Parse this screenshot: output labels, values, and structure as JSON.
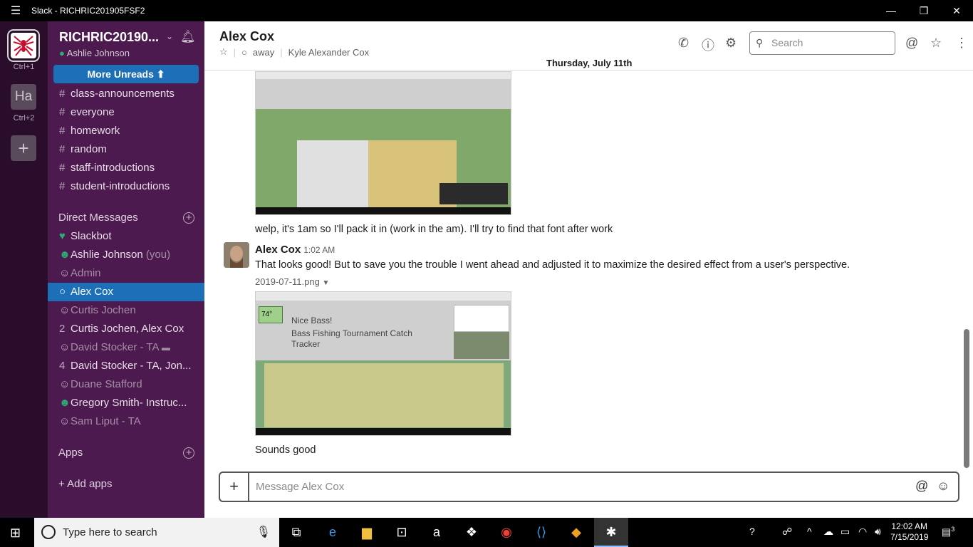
{
  "window": {
    "title": "Slack - RICHRIC201905FSF2",
    "menu_icon": "hamburger-icon",
    "minimize": "—",
    "maximize": "❐",
    "close": "✕"
  },
  "workspaces": [
    {
      "label": "Ctrl+1",
      "active": true
    },
    {
      "initials": "Ha",
      "label": "Ctrl+2"
    }
  ],
  "sidebar": {
    "team_name": "RICHRIC20190...",
    "user": "Ashlie Johnson",
    "more_unreads": "More Unreads",
    "channels": [
      "class-announcements",
      "everyone",
      "homework",
      "random",
      "staff-introductions",
      "student-introductions"
    ],
    "dm_header": "Direct Messages",
    "dms": [
      {
        "name": "Slackbot",
        "prefix": "♥",
        "faded": false
      },
      {
        "name": "Ashlie Johnson",
        "suffix": "(you)",
        "prefix": "☻",
        "faded": false
      },
      {
        "name": "Admin",
        "prefix": "☺",
        "faded": true
      },
      {
        "name": "Alex Cox",
        "prefix": "○",
        "faded": false,
        "active": true
      },
      {
        "name": "Curtis Jochen",
        "prefix": "☺",
        "faded": true
      },
      {
        "name": "Curtis Jochen, Alex Cox",
        "prefix": "2",
        "faded": false
      },
      {
        "name": "David Stocker - TA",
        "prefix": "☺",
        "faded": true
      },
      {
        "name": "David Stocker - TA, Jon...",
        "prefix": "4",
        "faded": false
      },
      {
        "name": "Duane Stafford",
        "prefix": "☺",
        "faded": true
      },
      {
        "name": "Gregory Smith- Instruc...",
        "prefix": "☻",
        "faded": false
      },
      {
        "name": "Sam Liput - TA",
        "prefix": "☺",
        "faded": true
      }
    ],
    "apps_header": "Apps",
    "add_apps": "+ Add apps"
  },
  "channel": {
    "name": "Alex Cox",
    "presence": "away",
    "full_name": "Kyle Alexander Cox",
    "search_placeholder": "Search",
    "date_divider": "Thursday, July 11th"
  },
  "messages": {
    "m1_text": "welp, it's 1am so I'll pack it in (work in the am). I'll try to find that font after work",
    "m2_sender": "Alex Cox",
    "m2_time": "1:02 AM",
    "m2_text": "That looks good! But to save you the trouble I went ahead and adjusted it to maximize the desired effect from a user's perspective.",
    "m2_file": "2019-07-11.png",
    "shot2_temp": "74°",
    "shot2_title": "Nice Bass!",
    "shot2_sub1": "Bass Fishing Tournament Catch",
    "shot2_sub2": "Tracker",
    "m3_text": "Sounds good"
  },
  "composer": {
    "placeholder": "Message Alex Cox"
  },
  "taskbar": {
    "search_text": "Type here to search",
    "time": "12:02 AM",
    "date": "7/15/2019",
    "notifications": "3"
  },
  "colors": {
    "sidebar_bg": "#4d1a4f",
    "rail_bg": "#2a0c2b",
    "accent": "#1d6fb8"
  }
}
